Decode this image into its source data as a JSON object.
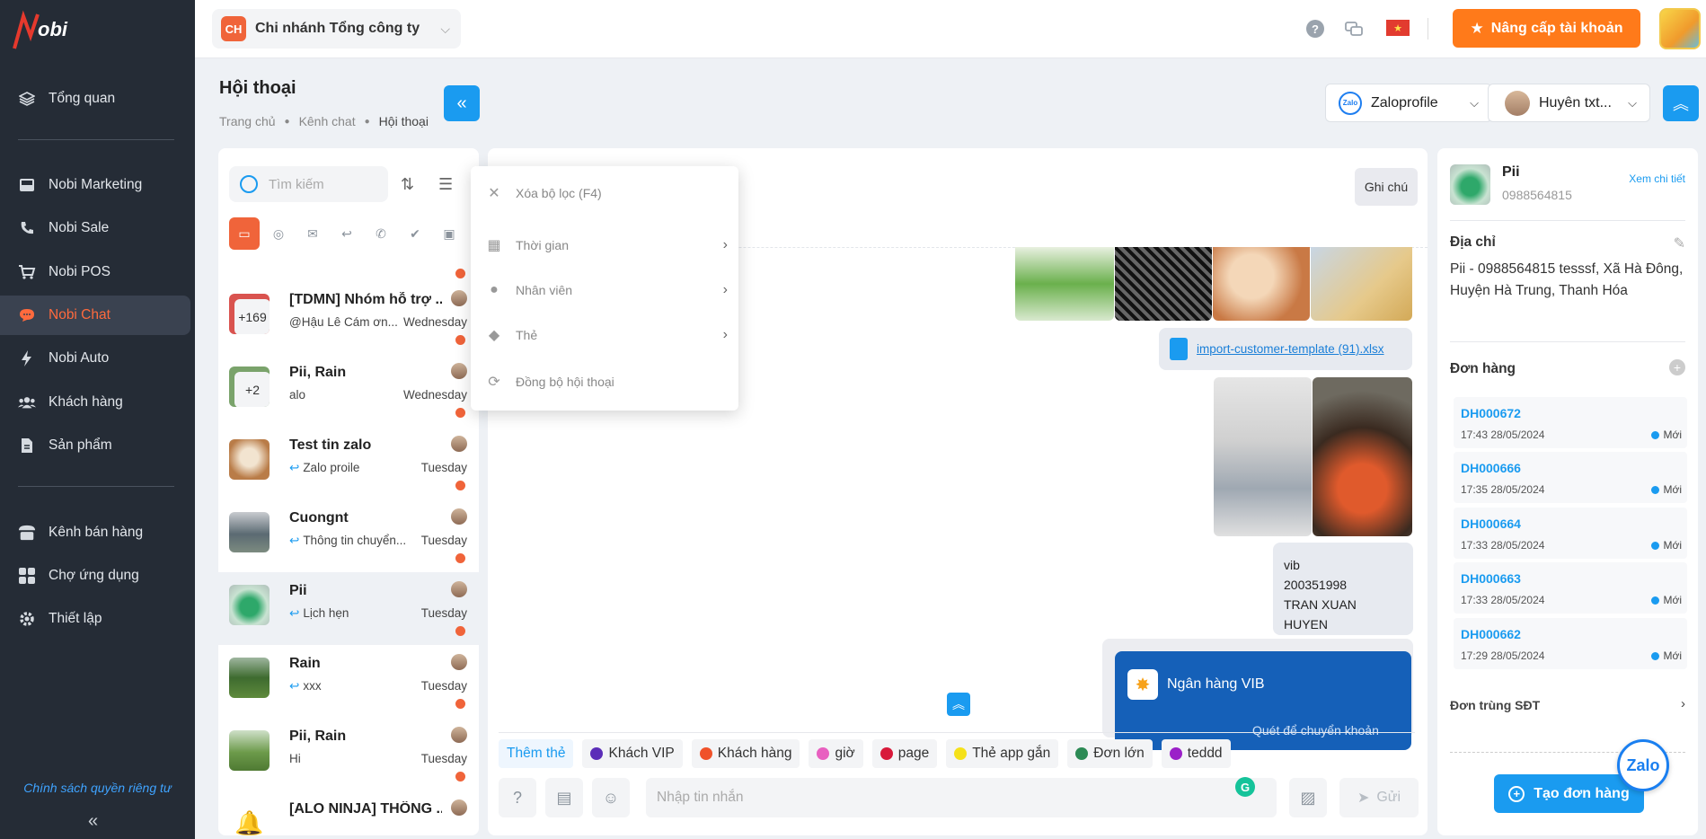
{
  "sidebar": {
    "logo_text": "Nobi",
    "items": [
      {
        "label": "Tổng quan",
        "icon": "layers-icon"
      },
      {
        "label": "Nobi Marketing",
        "icon": "inbox-icon"
      },
      {
        "label": "Nobi Sale",
        "icon": "phone-icon"
      },
      {
        "label": "Nobi POS",
        "icon": "cart-icon"
      },
      {
        "label": "Nobi Chat",
        "icon": "chat-icon"
      },
      {
        "label": "Nobi Auto",
        "icon": "lightning-icon"
      },
      {
        "label": "Khách hàng",
        "icon": "users-icon"
      },
      {
        "label": "Sản phẩm",
        "icon": "document-icon"
      },
      {
        "label": "Kênh bán hàng",
        "icon": "store-icon"
      },
      {
        "label": "Chợ ứng dụng",
        "icon": "grid-icon"
      },
      {
        "label": "Thiết lập",
        "icon": "gear-icon"
      }
    ],
    "active_index": 4,
    "privacy": "Chính sách quyền riêng tư"
  },
  "topbar": {
    "branch_badge": "CH",
    "branch_name": "Chi nhánh Tổng công ty",
    "upgrade_label": "Nâng cấp tài khoản",
    "accent": "#ff7a1a"
  },
  "page": {
    "title": "Hội thoại",
    "breadcrumbs": [
      "Trang chủ",
      "Kênh chat",
      "Hội thoại"
    ]
  },
  "filters": {
    "channel": "Zaloprofile",
    "user": "Huyên txt..."
  },
  "conversations": {
    "search_placeholder": "Tìm kiếm",
    "items": [
      {
        "title": "[TDMN] Nhóm hỗ trợ ...",
        "preview": "@Hậu Lê Cám ơn...",
        "time": "Wednesday",
        "count": "+169"
      },
      {
        "title": "Pii, Rain",
        "preview": "alo",
        "time": "Wednesday",
        "count": "+2"
      },
      {
        "title": "Test tin zalo",
        "preview": "Zalo proile",
        "time": "Tuesday",
        "count": ""
      },
      {
        "title": "Cuongnt",
        "preview": "Thông tin chuyển...",
        "time": "Tuesday",
        "count": ""
      },
      {
        "title": "Pii",
        "preview": "Lịch hẹn",
        "time": "Tuesday",
        "count": ""
      },
      {
        "title": "Rain",
        "preview": "xxx",
        "time": "Tuesday",
        "count": ""
      },
      {
        "title": "Pii, Rain",
        "preview": "Hi",
        "time": "Tuesday",
        "count": ""
      },
      {
        "title": "[ALO NINJA] THÔNG ...",
        "preview": "",
        "time": "",
        "count": ""
      }
    ]
  },
  "filter_menu": {
    "clear": "Xóa bộ lọc (F4)",
    "time": "Thời gian",
    "staff": "Nhân viên",
    "tag": "Thẻ",
    "sync": "Đồng bộ hội thoại"
  },
  "chat": {
    "note_label": "Ghi chú",
    "file_name": "import-customer-template (91).xlsx",
    "bank_lines": [
      "vib",
      "200351998",
      "TRAN XUAN HUYEN"
    ],
    "vib_name": "Ngân hàng VIB",
    "vib_sub": "Quét để chuyển khoản",
    "tags": [
      {
        "label": "Thêm thẻ",
        "color": ""
      },
      {
        "label": "Khách VIP",
        "color": "#5b2db8"
      },
      {
        "label": "Khách hàng",
        "color": "#f0522a"
      },
      {
        "label": "giờ",
        "color": "#e860c0"
      },
      {
        "label": "page",
        "color": "#d8193a"
      },
      {
        "label": "Thẻ app gắn",
        "color": "#f5e11a"
      },
      {
        "label": "Đơn lớn",
        "color": "#2c8a55"
      },
      {
        "label": "teddd",
        "color": "#9b20c8"
      }
    ],
    "input_placeholder": "Nhập tin nhắn",
    "send_label": "Gửi"
  },
  "customer": {
    "name": "Pii",
    "phone": "0988564815",
    "detail_link": "Xem chi tiết",
    "address_heading": "Địa chỉ",
    "address": "Pii - 0988564815 tesssf, Xã Hà Đông, Huyện Hà Trung, Thanh Hóa",
    "orders_heading": "Đơn hàng",
    "orders": [
      {
        "code": "DH000672",
        "time": "17:43 28/05/2024",
        "status": "Mới"
      },
      {
        "code": "DH000666",
        "time": "17:35 28/05/2024",
        "status": "Mới"
      },
      {
        "code": "DH000664",
        "time": "17:33 28/05/2024",
        "status": "Mới"
      },
      {
        "code": "DH000663",
        "time": "17:33 28/05/2024",
        "status": "Mới"
      },
      {
        "code": "DH000662",
        "time": "17:29 28/05/2024",
        "status": "Mới"
      }
    ],
    "duplicate": "Đơn trùng SĐT",
    "create_order": "Tạo đơn hàng",
    "zalo_float": "Zalo"
  }
}
